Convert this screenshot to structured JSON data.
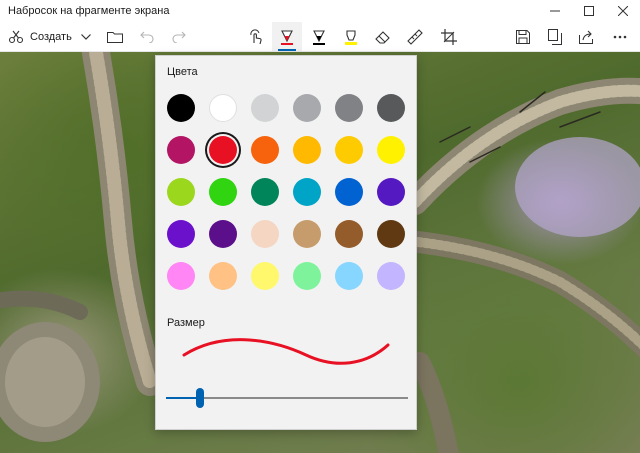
{
  "app": {
    "title": "Набросок на фрагменте экрана"
  },
  "window_controls": [
    "minimize-icon",
    "maximize-icon",
    "close-icon"
  ],
  "toolbar": {
    "create_label": "Создать",
    "tools": [
      "touch-writing-icon",
      "ballpoint-pen-icon",
      "pencil-icon",
      "highlighter-icon",
      "eraser-icon",
      "ruler-icon",
      "crop-icon"
    ],
    "right_actions": [
      "save-icon",
      "copy-icon",
      "share-icon",
      "more-icon"
    ],
    "active_tool": "ballpoint-pen-icon",
    "active_pen_color": "#e81123"
  },
  "color_flyout": {
    "colors_heading": "Цвета",
    "size_heading": "Размер",
    "selected_color": "#e81123",
    "size_level": 0.14,
    "colors": [
      "#000000",
      "#ffffff",
      "#d1d3d4",
      "#a7a9ac",
      "#808285",
      "#58595b",
      "#b31564",
      "#e81123",
      "#f7630c",
      "#ffb900",
      "#fecb00",
      "#fff100",
      "#9bd71d",
      "#30d411",
      "#00855a",
      "#00a4c7",
      "#0063d1",
      "#5519c2",
      "#6b11cc",
      "#5c0f8b",
      "#f4d6c3",
      "#c69c6d",
      "#945c2a",
      "#603913",
      "#ff86f4",
      "#ffc184",
      "#fff86d",
      "#7ef39b",
      "#87d6ff",
      "#c3b5ff"
    ]
  }
}
